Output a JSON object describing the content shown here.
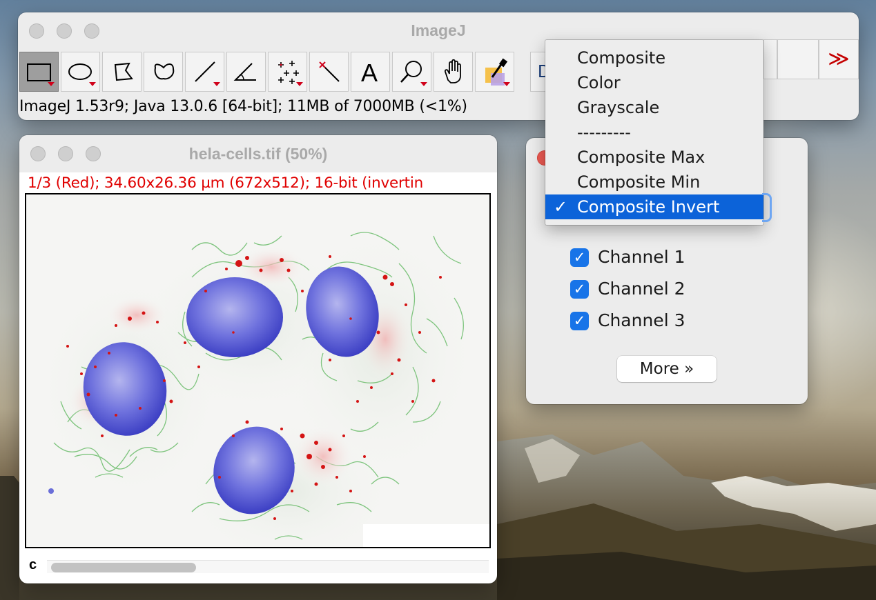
{
  "main_window": {
    "title": "ImageJ",
    "status": "ImageJ 1.53r9; Java 13.0.6 [64-bit]; 11MB of 7000MB (<1%)",
    "dev_button_label": "D",
    "more_tools_glyph": "≫",
    "tools": [
      {
        "name": "rectangle-tool",
        "icon": "rectangle-icon",
        "selected": true
      },
      {
        "name": "oval-tool",
        "icon": "oval-icon"
      },
      {
        "name": "polygon-tool",
        "icon": "polygon-icon"
      },
      {
        "name": "freehand-tool",
        "icon": "freehand-icon"
      },
      {
        "name": "line-tool",
        "icon": "line-icon"
      },
      {
        "name": "angle-tool",
        "icon": "angle-icon"
      },
      {
        "name": "multipoint-tool",
        "icon": "multipoint-icon"
      },
      {
        "name": "wand-tool",
        "icon": "wand-icon"
      },
      {
        "name": "text-tool",
        "icon": "text-icon",
        "glyph": "A"
      },
      {
        "name": "zoom-tool",
        "icon": "magnifier-icon"
      },
      {
        "name": "hand-tool",
        "icon": "hand-icon"
      },
      {
        "name": "color-picker-tool",
        "icon": "dropper-icon"
      }
    ]
  },
  "image_window": {
    "title": "hela-cells.tif (50%)",
    "info": "1/3 (Red); 34.60x26.36 µm (672x512); 16-bit (invertin",
    "channel_slider_label": "c",
    "colors": {
      "nuclei": "#4b4fd1",
      "mitochondria": "#3fae3f",
      "puncta": "#d41414"
    }
  },
  "channels_dialog": {
    "channels": [
      {
        "label": "Channel 1",
        "checked": true
      },
      {
        "label": "Channel 2",
        "checked": true
      },
      {
        "label": "Channel 3",
        "checked": true
      }
    ],
    "more_button": "More »"
  },
  "display_mode_menu": {
    "items": [
      {
        "label": "Composite"
      },
      {
        "label": "Color"
      },
      {
        "label": "Grayscale"
      },
      {
        "label": "---------",
        "separator": true
      },
      {
        "label": "Composite Max"
      },
      {
        "label": "Composite Min"
      },
      {
        "label": "Composite Invert",
        "selected": true,
        "check": "✓"
      }
    ],
    "highlight_color": "#0c63d9"
  }
}
